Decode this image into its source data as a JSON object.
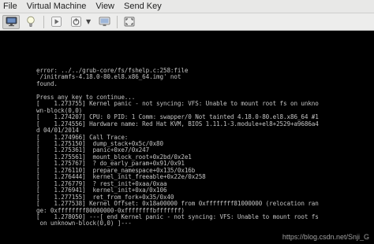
{
  "menu": {
    "file": "File",
    "virtual_machine": "Virtual Machine",
    "view": "View",
    "send_key": "Send Key"
  },
  "toolbar": {
    "icons": [
      "monitor-icon",
      "lightbulb-icon",
      "play-icon",
      "power-icon",
      "screenshot-icon",
      "fullscreen-icon"
    ]
  },
  "console": {
    "lines": [
      "error: ../../grub-core/fs/fshelp.c:258:file",
      "`/initramfs-4.18.0-80.el8.x86_64.img' not",
      "found.",
      "",
      "Press any key to continue...",
      "[    1.273755] Kernel panic - not syncing: VFS: Unable to mount root fs on unkno",
      "wn-block(0,0)",
      "[    1.274207] CPU: 0 PID: 1 Comm: swapper/0 Not tainted 4.18.0-80.el8.x86_64 #1",
      "[    1.274556] Hardware name: Red Hat KVM, BIOS 1.11.1-3.module+el8+2529+a9686a4",
      "d 04/01/2014",
      "[    1.274966] Call Trace:",
      "[    1.275150]  dump_stack+0x5c/0x80",
      "[    1.275361]  panic+0xe7/0x247",
      "[    1.275561]  mount_block_root+0x2bd/0x2e1",
      "[    1.275767]  ? do_early_param+0x91/0x91",
      "[    1.276110]  prepare_namespace+0x135/0x16b",
      "[    1.276444]  kernel_init_freeable+0x22e/0x258",
      "[    1.276779]  ? rest_init+0xaa/0xaa",
      "[    1.276941]  kernel_init+0xa/0x106",
      "[    1.277155]  ret_from_fork+0x35/0x40",
      "[    1.277538] Kernel Offset: 0x18a00000 from 0xffffffff81000000 (relocation ran",
      "ge: 0xffffffff80000000-0xffffffffbfffffff)",
      "[    1.278050] ---[ end Kernel panic - not syncing: VFS: Unable to mount root fs",
      " on unknown-block(0,0) ]---"
    ]
  },
  "watermark": "https://blog.csdn.net/Snji_G"
}
